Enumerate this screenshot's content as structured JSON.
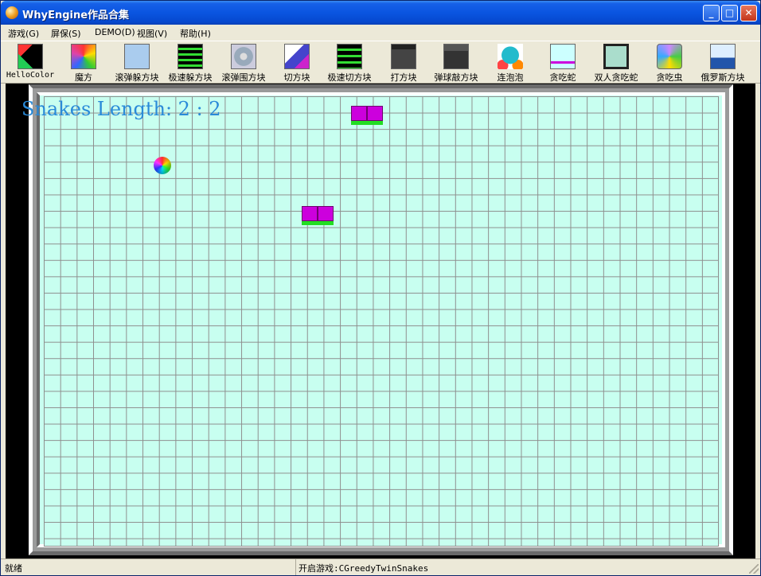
{
  "window": {
    "title": "WhyEngine作品合集"
  },
  "menu": {
    "items": [
      "游戏(G)",
      "屏保(S)",
      "DEMO(D)",
      "视图(V)",
      "帮助(H)"
    ]
  },
  "toolbar": {
    "items": [
      {
        "label": "HelloColor",
        "icon": "hellocolor-icon",
        "color": "#22cc55"
      },
      {
        "label": "魔方",
        "icon": "cube-icon",
        "color": "#dd44aa"
      },
      {
        "label": "滚弹躲方块",
        "icon": "dodge-icon",
        "color": "#aaccee"
      },
      {
        "label": "极速躲方块",
        "icon": "fast-dodge-icon",
        "color": "#33aa33"
      },
      {
        "label": "滚弹围方块",
        "icon": "surround-icon",
        "color": "#99aabb"
      },
      {
        "label": "切方块",
        "icon": "cut-icon",
        "color": "#4444cc"
      },
      {
        "label": "极速切方块",
        "icon": "fast-cut-icon",
        "color": "#33aa33"
      },
      {
        "label": "打方块",
        "icon": "breakout-icon",
        "color": "#444444"
      },
      {
        "label": "弹球敲方块",
        "icon": "pinball-icon",
        "color": "#555555"
      },
      {
        "label": "连泡泡",
        "icon": "bubble-icon",
        "color": "#22bbcc"
      },
      {
        "label": "贪吃蛇",
        "icon": "snake-icon",
        "color": "#ccffff"
      },
      {
        "label": "双人贪吃蛇",
        "icon": "twin-snake-icon",
        "color": "#aaddcc"
      },
      {
        "label": "贪吃虫",
        "icon": "worm-icon",
        "color": "#cc88ff"
      },
      {
        "label": "俄罗斯方块",
        "icon": "tetris-icon",
        "color": "#2255aa"
      }
    ]
  },
  "game": {
    "score_text": "Snakes Length: 2 : 2",
    "colors": {
      "background": "#c8fff0",
      "grid": "#8e8e8e",
      "snake_body": "#cc00dd",
      "snake_belly": "#22dd22",
      "score": "#2a8ad8"
    }
  },
  "status": {
    "left": "就绪",
    "right": "开启游戏:CGreedyTwinSnakes"
  }
}
